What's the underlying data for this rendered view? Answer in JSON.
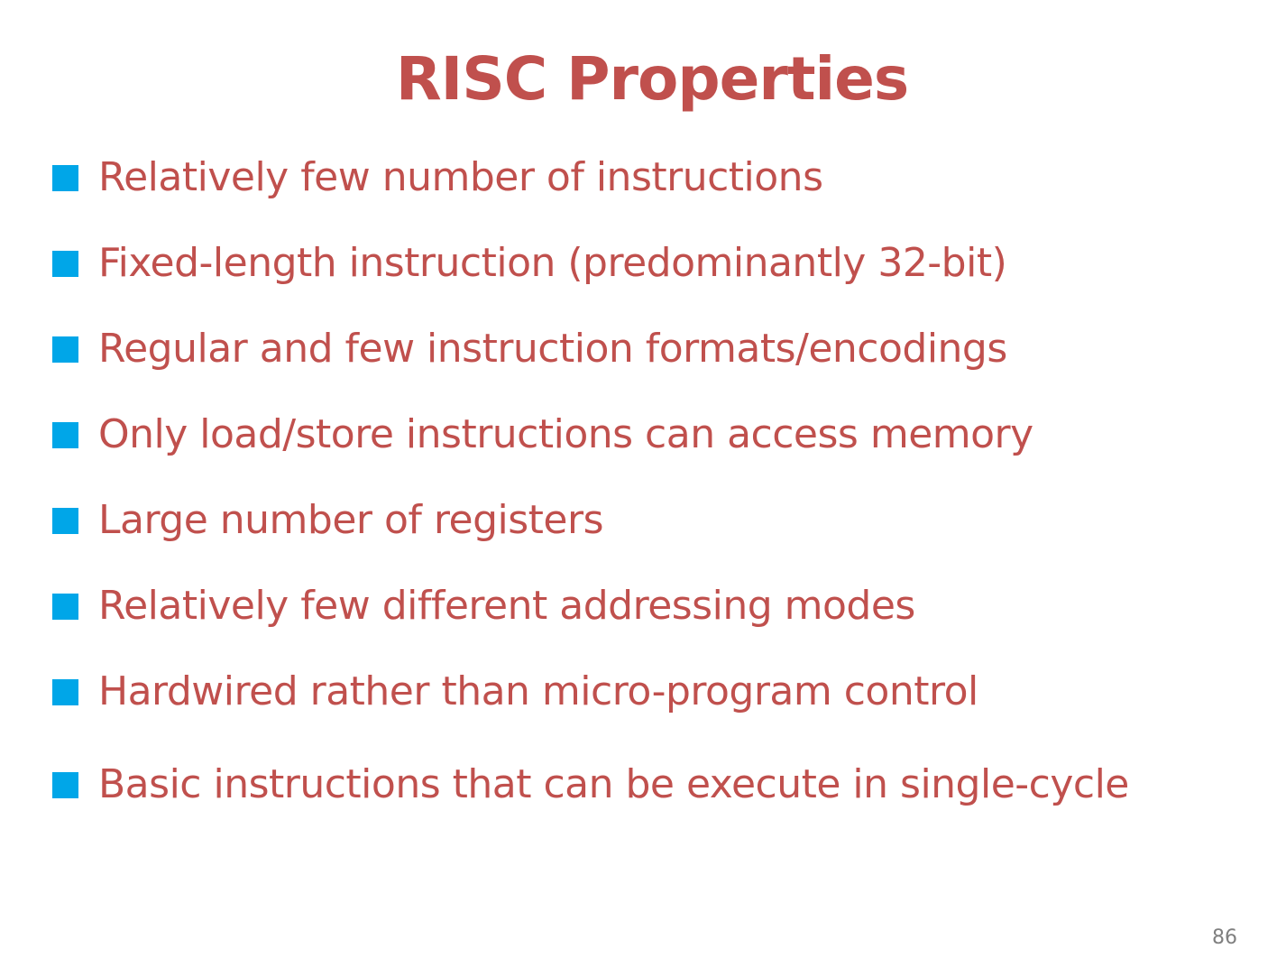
{
  "slide": {
    "title": "RISC Properties",
    "bullets": [
      "Relatively few number of instructions",
      "Fixed-length instruction (predominantly 32-bit)",
      "Regular and few instruction formats/encodings",
      "Only load/store instructions can access memory",
      "Large number of registers",
      "Relatively few different addressing modes",
      "Hardwired rather than micro-program control",
      "Basic instructions that can be execute in single-cycle"
    ],
    "page_number": "86"
  },
  "colors": {
    "text": "#c0504d",
    "bullet_marker": "#00a6e8",
    "page_number": "#7f7f7f",
    "background": "#ffffff"
  },
  "icons": {
    "bullet_marker": "square-bullet-icon"
  }
}
